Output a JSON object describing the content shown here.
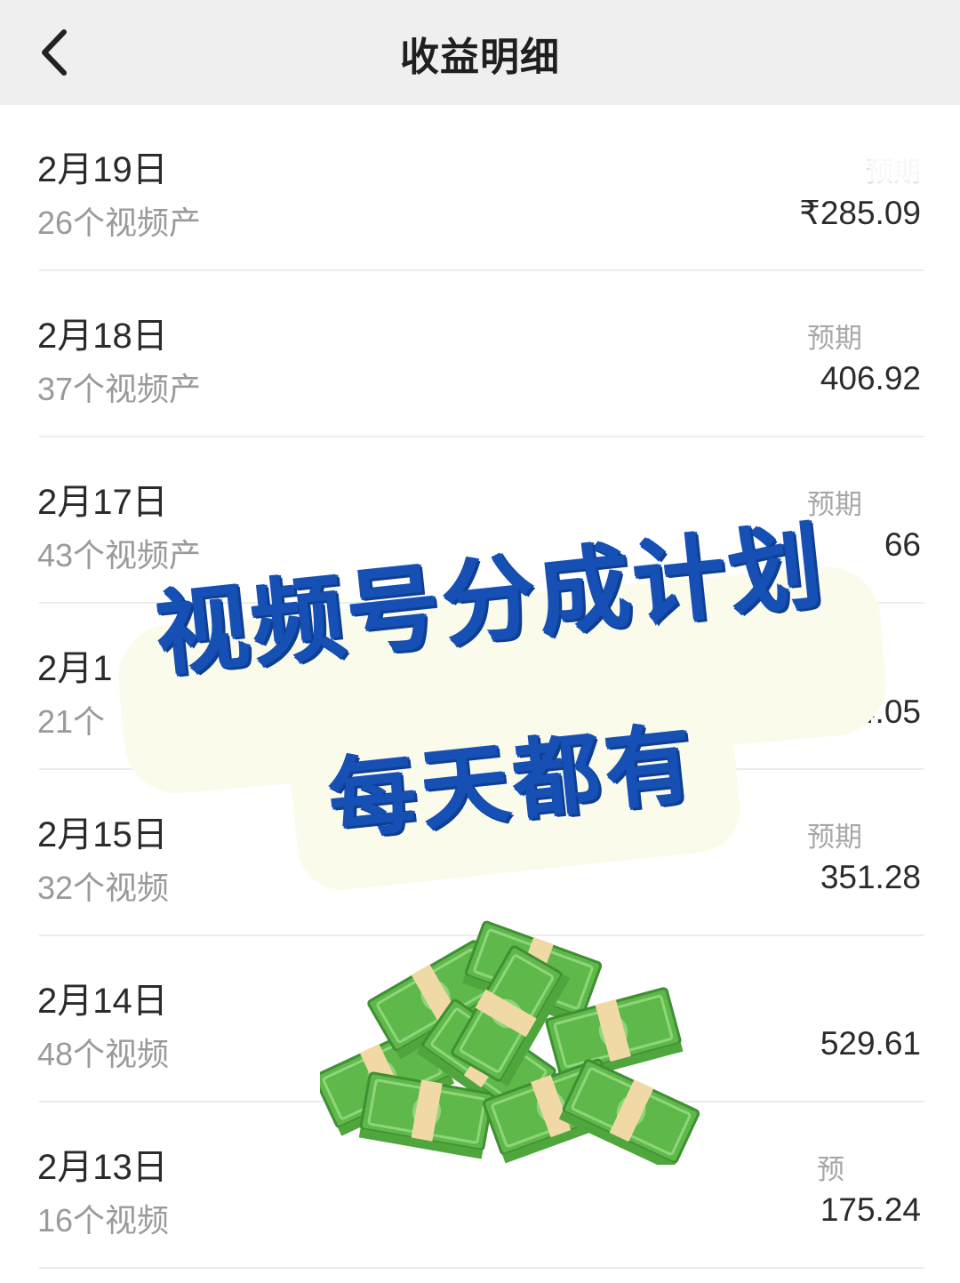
{
  "header": {
    "title": "收益明细"
  },
  "colors": {
    "header_bg": "#efefef",
    "banner_text": "#1650b4",
    "banner_bg": "#fbfbec",
    "cash_green": "#5fb84a"
  },
  "rows": [
    {
      "date": "2月19日",
      "sub": "26个视频产",
      "plabel": "预期",
      "amount": "₹285.09"
    },
    {
      "date": "2月18日",
      "sub": "37个视频产",
      "plabel": "预期",
      "amount": "406.92"
    },
    {
      "date": "2月17日",
      "sub": "43个视频产",
      "plabel": "预期",
      "amount": "66"
    },
    {
      "date": "2月1",
      "sub": "21个",
      "plabel": "",
      "amount": "₹234.05"
    },
    {
      "date": "2月15日",
      "sub": "32个视频",
      "plabel": "预期",
      "amount": "351.28"
    },
    {
      "date": "2月14日",
      "sub": "48个视频",
      "plabel": "",
      "amount": "529.61"
    },
    {
      "date": "2月13日",
      "sub": "16个视频",
      "plabel": "预",
      "amount": "175.24"
    }
  ],
  "overlay": {
    "line1": "视频号分成计划",
    "line2": "每天都有"
  }
}
